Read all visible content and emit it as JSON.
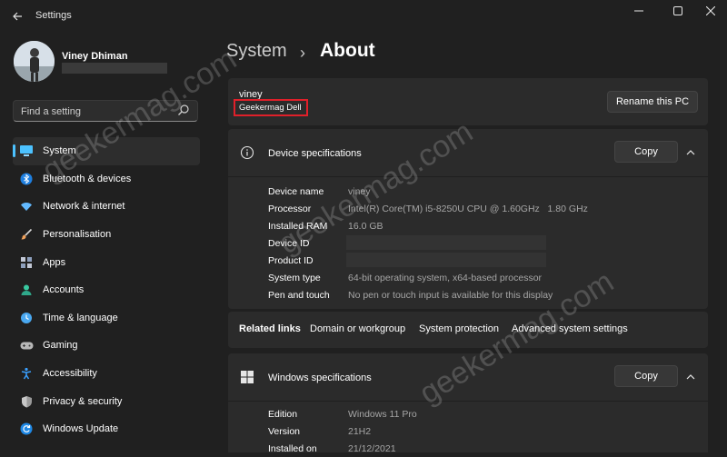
{
  "window": {
    "title": "Settings",
    "back_icon": "arrow-left",
    "min_icon": "minimize",
    "max_icon": "maximize",
    "close_icon": "close"
  },
  "profile": {
    "name": "Viney Dhiman"
  },
  "search": {
    "placeholder": "Find a setting"
  },
  "sidebar": {
    "items": [
      {
        "label": "System",
        "icon": "monitor-icon",
        "color": "#4cc2ff",
        "active": true
      },
      {
        "label": "Bluetooth & devices",
        "icon": "bluetooth-icon",
        "color": "#3a9bff"
      },
      {
        "label": "Network & internet",
        "icon": "wifi-icon",
        "color": "#62b9ff"
      },
      {
        "label": "Personalisation",
        "icon": "brush-icon",
        "color": "#f0a15b"
      },
      {
        "label": "Apps",
        "icon": "apps-icon",
        "color": "#c2c8d6"
      },
      {
        "label": "Accounts",
        "icon": "person-icon",
        "color": "#39c9a0"
      },
      {
        "label": "Time & language",
        "icon": "globe-icon",
        "color": "#4aa8f0"
      },
      {
        "label": "Gaming",
        "icon": "gamepad-icon",
        "color": "#c8c8c8"
      },
      {
        "label": "Accessibility",
        "icon": "accessibility-icon",
        "color": "#3aa0ff"
      },
      {
        "label": "Privacy & security",
        "icon": "shield-icon",
        "color": "#a0a0a0"
      },
      {
        "label": "Windows Update",
        "icon": "update-icon",
        "color": "#3aa0ff"
      }
    ]
  },
  "breadcrumb": {
    "parent": "System",
    "separator": "›",
    "current": "About"
  },
  "pc": {
    "name": "viney",
    "model": "Geekermag Dell",
    "rename_label": "Rename this PC",
    "highlight_color": "#e0202a"
  },
  "device_specs": {
    "title": "Device specifications",
    "copy_label": "Copy",
    "rows": [
      {
        "key": "Device name",
        "value": "viney"
      },
      {
        "key": "Processor",
        "value": "Intel(R) Core(TM) i5-8250U CPU @ 1.60GHz   1.80 GHz"
      },
      {
        "key": "Installed RAM",
        "value": "16.0 GB"
      },
      {
        "key": "Device ID",
        "value": ""
      },
      {
        "key": "Product ID",
        "value": ""
      },
      {
        "key": "System type",
        "value": "64-bit operating system, x64-based processor"
      },
      {
        "key": "Pen and touch",
        "value": "No pen or touch input is available for this display"
      }
    ]
  },
  "related_links": {
    "heading": "Related links",
    "items": [
      "Domain or workgroup",
      "System protection",
      "Advanced system settings"
    ]
  },
  "windows_specs": {
    "title": "Windows specifications",
    "copy_label": "Copy",
    "rows": [
      {
        "key": "Edition",
        "value": "Windows 11 Pro"
      },
      {
        "key": "Version",
        "value": "21H2"
      },
      {
        "key": "Installed on",
        "value": "21/12/2021"
      }
    ]
  },
  "watermark": {
    "text": "geekermag.com"
  },
  "theme": {
    "accent": "#4cc2ff",
    "background": "#202020",
    "card": "#2b2b2b"
  }
}
